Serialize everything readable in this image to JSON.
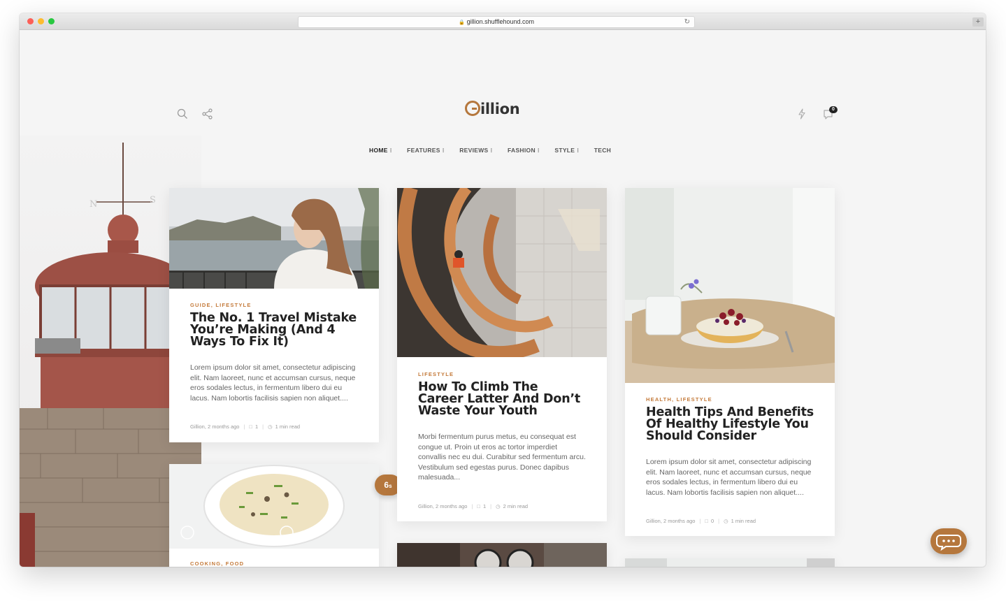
{
  "browser": {
    "url": "gillion.shufflehound.com"
  },
  "header": {
    "logo_text": "illion",
    "cart_count": "0"
  },
  "nav": {
    "items": [
      {
        "label": "HOME",
        "has_menu": true
      },
      {
        "label": "FEATURES",
        "has_menu": true
      },
      {
        "label": "REVIEWS",
        "has_menu": true
      },
      {
        "label": "FASHION",
        "has_menu": true
      },
      {
        "label": "STYLE",
        "has_menu": true
      },
      {
        "label": "TECH",
        "has_menu": false
      }
    ],
    "menu_indicator": "⁝"
  },
  "posts": [
    {
      "category": "GUIDE, LIFESTYLE",
      "title": "The No. 1 Travel Mistake You’re Making (And 4 Ways To Fix It)",
      "excerpt": "Lorem ipsum dolor sit amet, consectetur adipiscing elit. Nam laoreet, nunc et accumsan cursus, neque eros sodales lectus, in fermentum libero dui eu lacus. Nam lobortis facilisis sapien non aliquet....",
      "author_time": "Gillion, 2 months ago",
      "comments": "1",
      "read_time": "1 min read"
    },
    {
      "category": "LIFESTYLE",
      "title": "How To Climb The Career Latter And Don’t Waste Your Youth",
      "excerpt": "Morbi fermentum purus metus, eu consequat est congue ut. Proin ut eros ac tortor imperdiet convallis nec eu dui. Curabitur sed fermentum arcu. Vestibulum sed egestas purus. Donec dapibus malesuada...",
      "author_time": "Gillion, 2 months ago",
      "comments": "1",
      "read_time": "2 min read"
    },
    {
      "category": "HEALTH, LIFESTYLE",
      "title": "Health Tips And Benefits Of Healthy Lifestyle You Should Consider",
      "excerpt": "Lorem ipsum dolor sit amet, consectetur adipiscing elit. Nam laoreet, nunc et accumsan cursus, neque eros sodales lectus, in fermentum libero dui eu lacus. Nam lobortis facilisis sapien non aliquet....",
      "author_time": "Gillion, 2 months ago",
      "comments": "0",
      "read_time": "1 min read"
    },
    {
      "category": "COOKING, FOOD"
    }
  ],
  "views_badge": {
    "value": "6",
    "unit": "s"
  },
  "icons": {
    "search": "search-icon",
    "share": "share-icon",
    "flash": "lightning-icon",
    "cart": "cart-icon",
    "chat": "chat-bubble-icon",
    "comment": "comment-icon",
    "clock": "clock-icon"
  },
  "colors": {
    "accent": "#b5773d",
    "category": "#c47a3a",
    "background": "#f5f5f5"
  }
}
